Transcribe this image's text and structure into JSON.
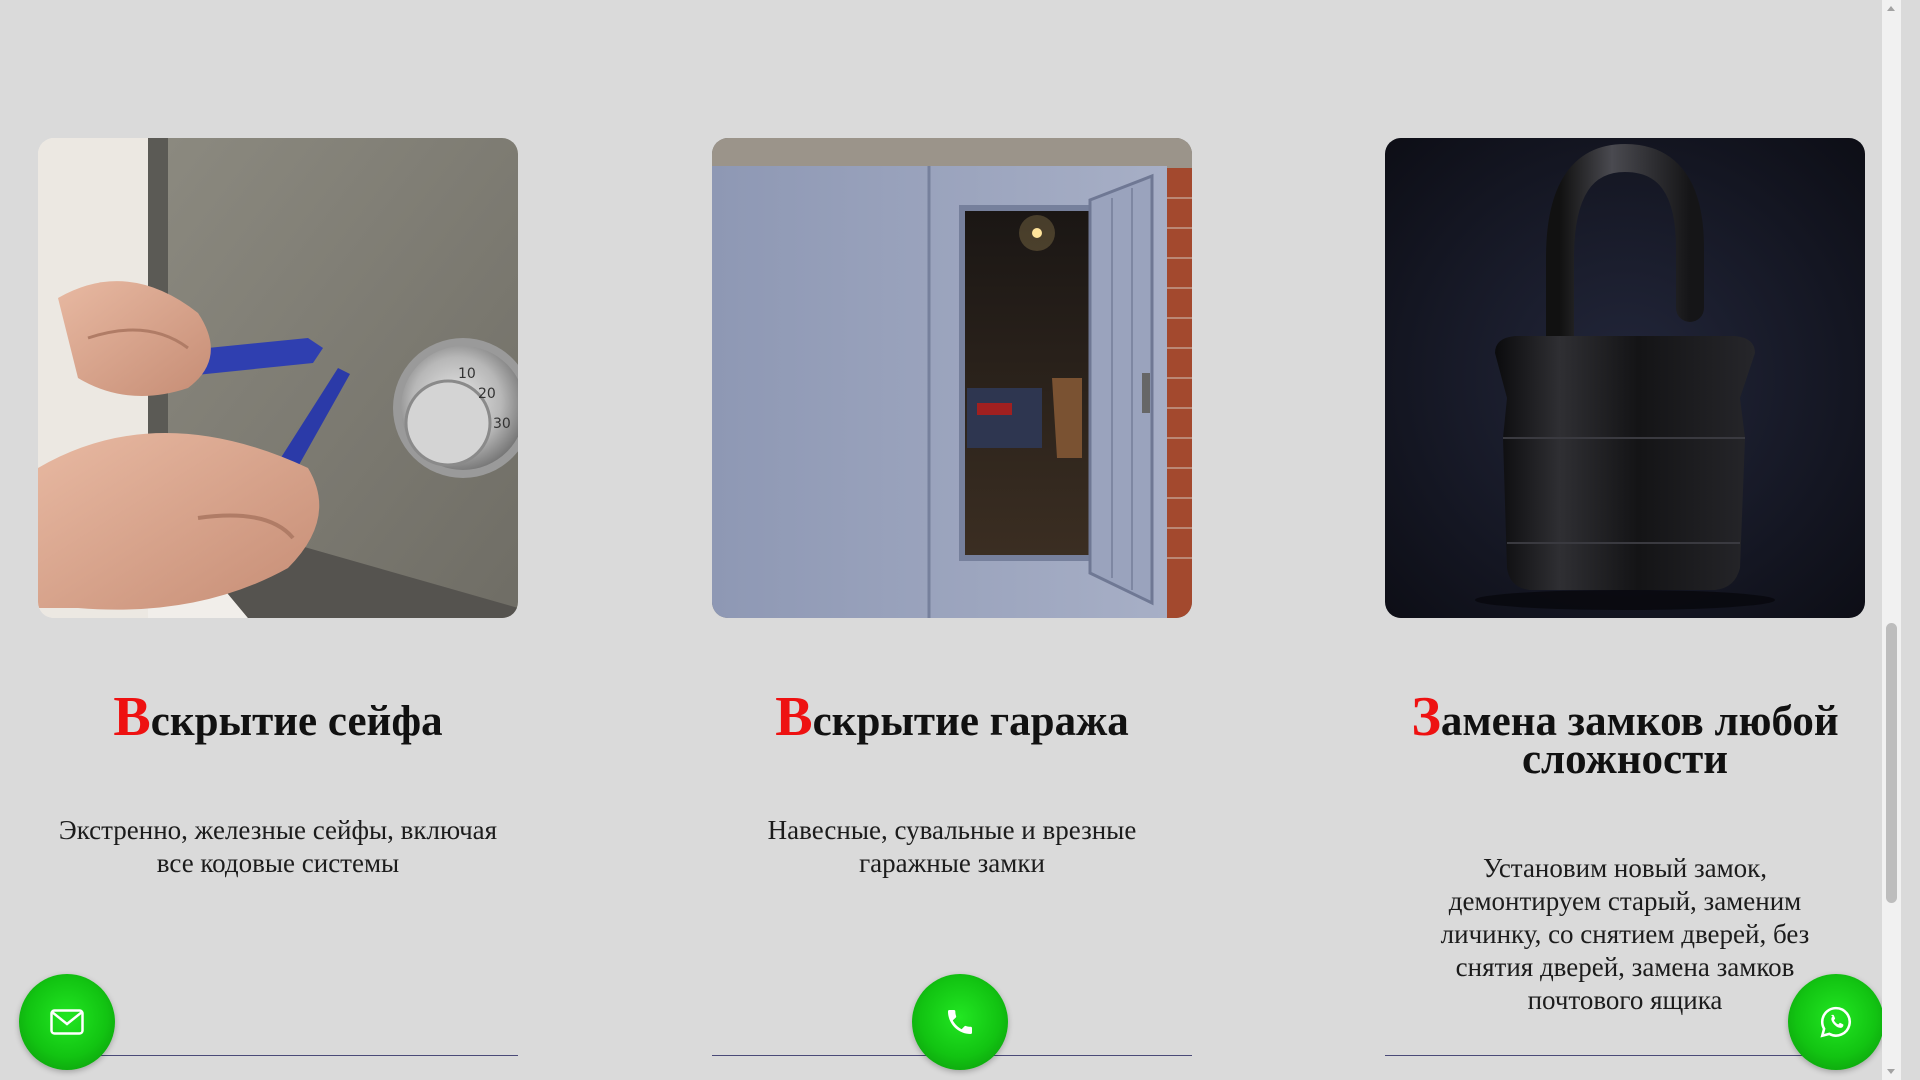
{
  "cards": [
    {
      "title_first": "В",
      "title_rest": "скрытие сейфа",
      "description": "Экстренно, железные сейфы, включая все кодовые системы",
      "image": "safe-unlocking-photo"
    },
    {
      "title_first": "В",
      "title_rest": "скрытие гаража",
      "description": "Навесные, сувальные и врезные гаражные замки",
      "image": "garage-door-photo"
    },
    {
      "title_first": "З",
      "title_rest": "амена замков любой сложности",
      "description": "Установим новый замок, демонтируем старый, заменим личинку, со снятием дверей, без снятия дверей, замена замков почтового ящика",
      "image": "padlock-photo"
    }
  ],
  "floating_buttons": {
    "mail": {
      "icon": "mail-icon"
    },
    "phone": {
      "icon": "phone-icon"
    },
    "whatsapp": {
      "icon": "whatsapp-icon"
    }
  },
  "colors": {
    "background": "#dadada",
    "accent_red": "#ee1111",
    "fab_green": "#12c412",
    "divider": "#4a4a78"
  }
}
